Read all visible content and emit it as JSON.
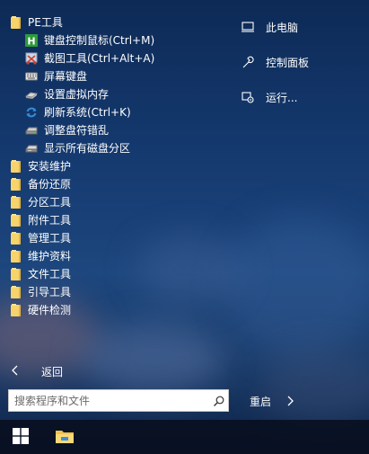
{
  "menu": {
    "pe_tools": "PE工具",
    "pe_children": [
      "键盘控制鼠标(Ctrl+M)",
      "截图工具(Ctrl+Alt+A)",
      "屏幕键盘",
      "设置虚拟内存",
      "刷新系统(Ctrl+K)",
      "调整盘符错乱",
      "显示所有磁盘分区"
    ],
    "folders": [
      "安装维护",
      "备份还原",
      "分区工具",
      "附件工具",
      "管理工具",
      "维护资料",
      "文件工具",
      "引导工具",
      "硬件检测"
    ]
  },
  "right_panel": {
    "computer": "此电脑",
    "control_panel": "控制面板",
    "run": "运行..."
  },
  "back_label": "返回",
  "search": {
    "placeholder": "搜索程序和文件"
  },
  "restart_label": "重启",
  "icons": {
    "folder": "folder-icon",
    "keyboard_mouse": "h-app-icon",
    "screenshot": "scissors-icon",
    "screen_keyboard": "keyboard-icon",
    "virtual_memory": "memory-icon",
    "refresh": "refresh-icon",
    "drive_letter": "drive-icon",
    "show_partitions": "disk-icon",
    "computer": "monitor-icon",
    "control_panel": "wrench-icon",
    "run": "run-icon",
    "back": "chevron-left-icon",
    "search": "search-icon",
    "restart": "chevron-right-icon",
    "start": "windows-logo-icon",
    "explorer": "file-explorer-icon"
  },
  "colors": {
    "accent_green": "#2e9a3a",
    "refresh_blue": "#2f8fd8",
    "folder_yellow": "#f7d36b"
  }
}
